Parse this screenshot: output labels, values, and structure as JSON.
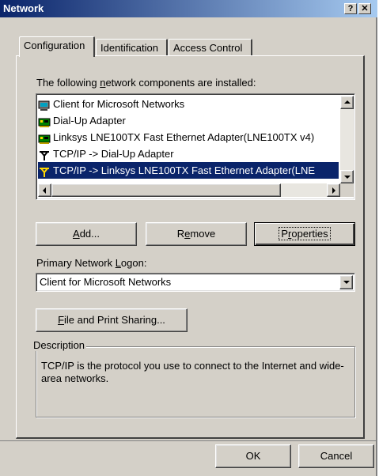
{
  "window": {
    "title": "Network",
    "help_label": "?",
    "close_label": "✕"
  },
  "tabs": [
    {
      "label": "Configuration",
      "active": true
    },
    {
      "label": "Identification",
      "active": false
    },
    {
      "label": "Access Control",
      "active": false
    }
  ],
  "components": {
    "label_pre": "The following ",
    "label_accel": "n",
    "label_post": "etwork components are installed:",
    "items": [
      {
        "label": "Client for Microsoft Networks",
        "icon": "client-icon",
        "selected": false
      },
      {
        "label": "Dial-Up Adapter",
        "icon": "adapter-icon",
        "selected": false
      },
      {
        "label": "Linksys LNE100TX Fast Ethernet Adapter(LNE100TX v4)",
        "icon": "adapter-icon",
        "selected": false
      },
      {
        "label": "TCP/IP -> Dial-Up Adapter",
        "icon": "protocol-icon",
        "selected": false
      },
      {
        "label": "TCP/IP -> Linksys LNE100TX Fast Ethernet Adapter(LNE",
        "icon": "protocol-icon",
        "selected": true
      }
    ]
  },
  "buttons": {
    "add": {
      "accel": "A",
      "rest": "dd..."
    },
    "remove": {
      "pre": "R",
      "accel": "e",
      "rest": "move"
    },
    "properties": {
      "pre": "P",
      "accel": "r",
      "rest": "operties"
    }
  },
  "logon": {
    "label_pre": "Primary Network ",
    "label_accel": "L",
    "label_post": "ogon:",
    "value": "Client for Microsoft Networks"
  },
  "sharing": {
    "accel": "F",
    "rest": "ile and Print Sharing..."
  },
  "description": {
    "title": "Description",
    "text": "TCP/IP is the protocol you use to connect to the Internet and wide-area networks."
  },
  "footer": {
    "ok_label": "OK",
    "cancel_label": "Cancel"
  },
  "colors": {
    "face": "#d4d0c8",
    "selection": "#0a246a",
    "title_start": "#0a246a",
    "title_end": "#a6caf0"
  }
}
